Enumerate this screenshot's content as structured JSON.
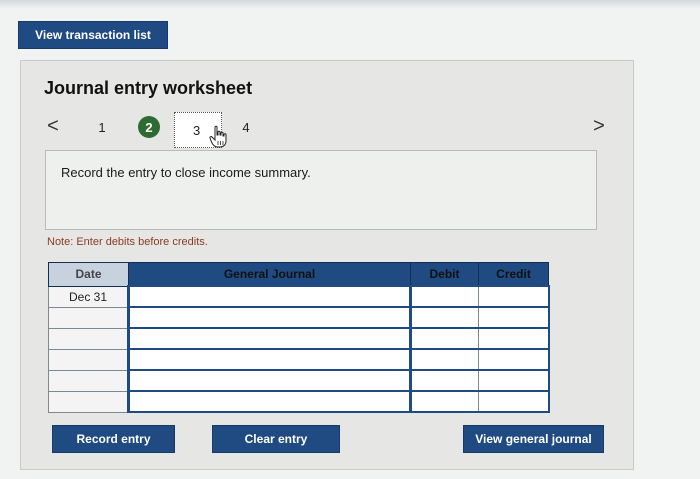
{
  "buttons": {
    "view_transaction_list": "View transaction list",
    "record_entry": "Record entry",
    "clear_entry": "Clear entry",
    "view_general_journal": "View general journal"
  },
  "worksheet": {
    "title": "Journal entry worksheet",
    "nav_prev": "<",
    "nav_next": ">",
    "steps": [
      "1",
      "2",
      "3",
      "4"
    ],
    "active_step": "2",
    "instruction": "Record the entry to close income summary.",
    "note": "Note: Enter debits before credits."
  },
  "table": {
    "headers": {
      "date": "Date",
      "general_journal": "General Journal",
      "debit": "Debit",
      "credit": "Credit"
    },
    "rows": [
      {
        "date": "Dec 31",
        "account": "",
        "debit": "",
        "credit": ""
      },
      {
        "date": "",
        "account": "",
        "debit": "",
        "credit": ""
      },
      {
        "date": "",
        "account": "",
        "debit": "",
        "credit": ""
      },
      {
        "date": "",
        "account": "",
        "debit": "",
        "credit": ""
      },
      {
        "date": "",
        "account": "",
        "debit": "",
        "credit": ""
      },
      {
        "date": "",
        "account": "",
        "debit": "",
        "credit": ""
      }
    ]
  },
  "colors": {
    "button_blue": "#1f4a82",
    "step_active": "#2e6b33",
    "note_text": "#8a3b23"
  },
  "icons": {
    "cursor": "hand-pointer-icon"
  }
}
